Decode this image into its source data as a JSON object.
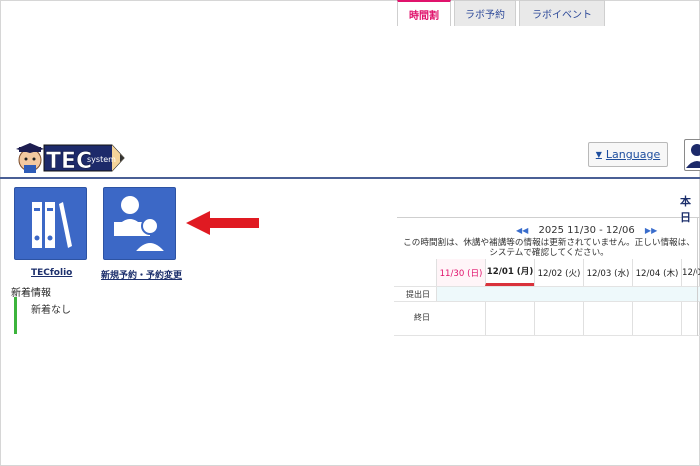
{
  "header": {
    "logo_text": "TEC",
    "logo_subtext": "system",
    "language_label": "Language"
  },
  "tiles": [
    {
      "label": "TECfolio",
      "icon": "binder-icon"
    },
    {
      "label": "新規予約・予約変更",
      "icon": "users-icon"
    }
  ],
  "news": {
    "title": "新着情報",
    "empty_text": "新着なし"
  },
  "timetable": {
    "tabs": [
      {
        "label": "時間割",
        "active": true
      },
      {
        "label": "ラボ予約",
        "active": false
      },
      {
        "label": "ラボイベント",
        "active": false
      }
    ],
    "today_label": "本日",
    "week_range": "2025 11/30 - 12/06",
    "notice_line1": "この時間割は、休講や補講等の情報は更新されていません。正しい情報は、",
    "notice_line2": "システムで確認してください。",
    "days": [
      "11/30 (日)",
      "12/01 (月)",
      "12/02 (火)",
      "12/03 (水)",
      "12/04 (木)",
      "12/0"
    ],
    "rows": [
      "提出日",
      "終日"
    ]
  },
  "colors": {
    "accent_pink": "#e0136c",
    "tile_blue": "#3c68c6",
    "header_line": "#4a5f95",
    "arrow_red": "#e01a22",
    "news_green": "#3cb43c"
  }
}
